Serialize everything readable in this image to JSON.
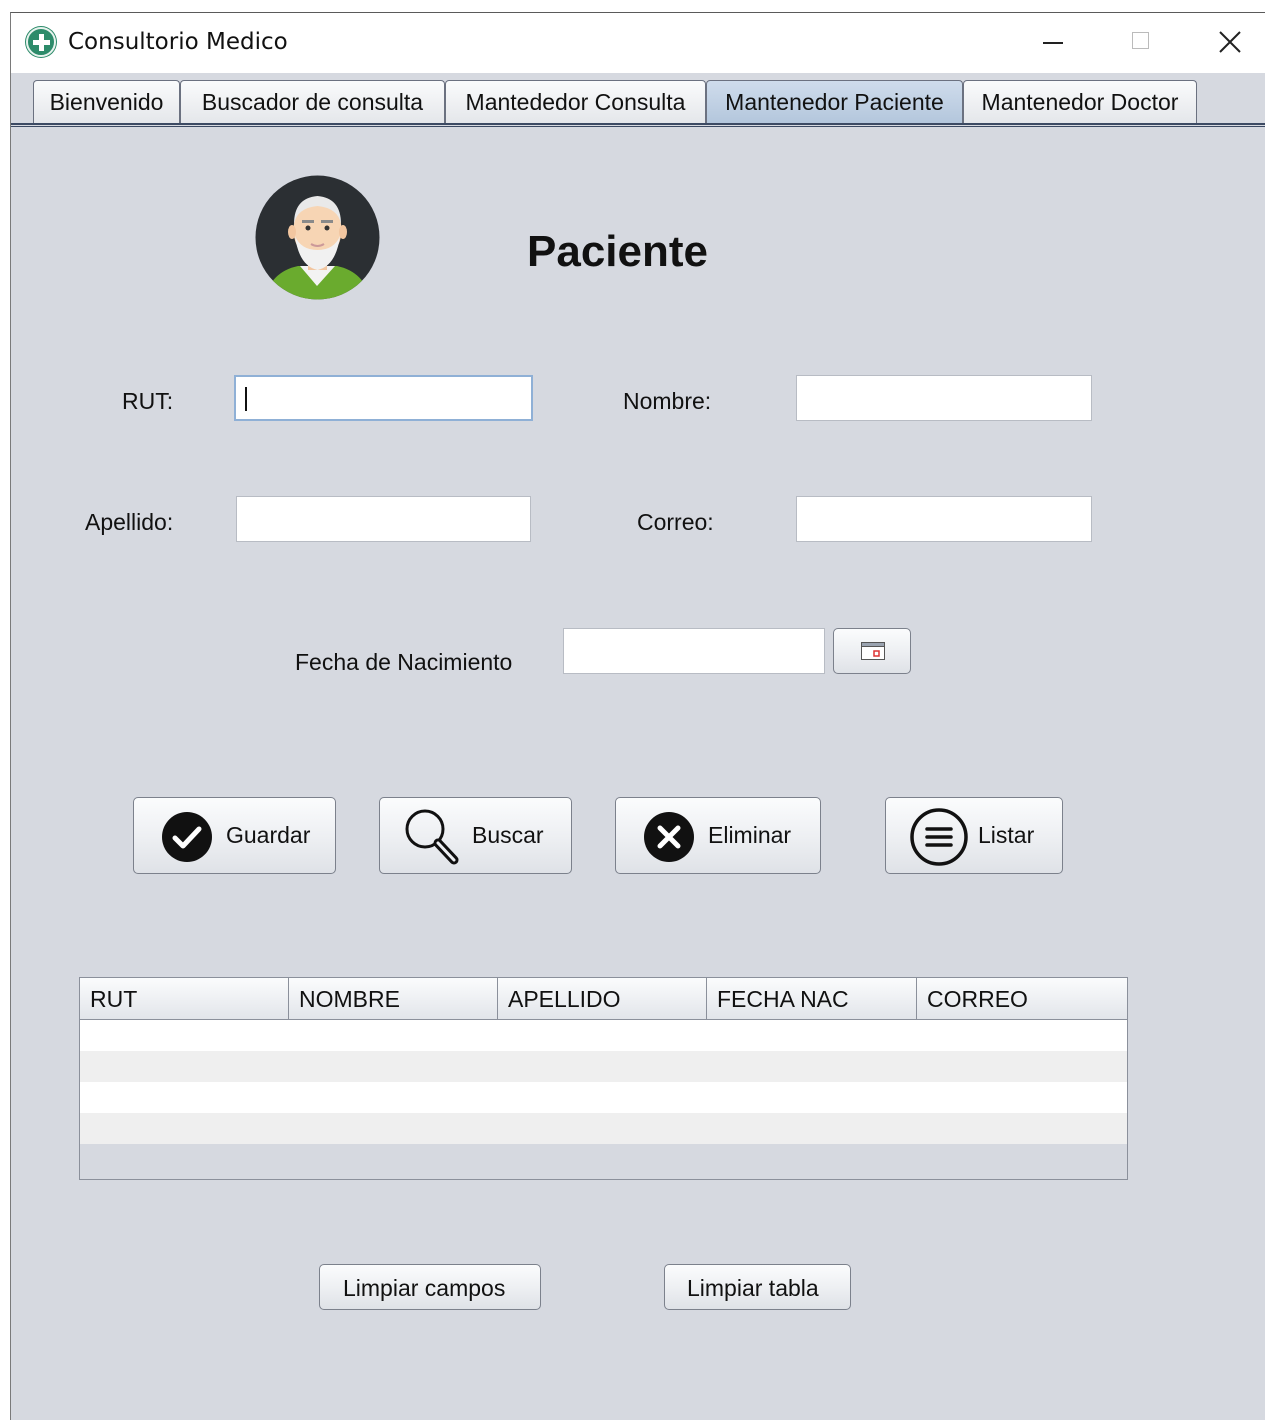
{
  "window": {
    "title": "Consultorio Medico",
    "app_icon": "medical-cross-icon",
    "controls": [
      "minimize-icon",
      "maximize-icon",
      "close-icon"
    ]
  },
  "tabs": [
    {
      "label": "Bienvenido",
      "selected": false
    },
    {
      "label": "Buscador de consulta",
      "selected": false
    },
    {
      "label": "Mantededor Consulta",
      "selected": false
    },
    {
      "label": "Mantenedor Paciente",
      "selected": true
    },
    {
      "label": "Mantenedor Doctor",
      "selected": false
    }
  ],
  "form": {
    "heading": "Paciente",
    "avatar_icon": "elderly-patient-avatar-icon",
    "rut": {
      "label": "RUT:",
      "value": ""
    },
    "nombre": {
      "label": "Nombre:",
      "value": ""
    },
    "apellido": {
      "label": "Apellido:",
      "value": ""
    },
    "correo": {
      "label": "Correo:",
      "value": ""
    },
    "fecha_nacimiento": {
      "label": "Fecha de Nacimiento",
      "value": "",
      "picker_icon": "calendar-icon"
    }
  },
  "actions": {
    "guardar": {
      "label": "Guardar",
      "icon": "checkmark-circle-icon"
    },
    "buscar": {
      "label": "Buscar",
      "icon": "magnifier-icon"
    },
    "eliminar": {
      "label": "Eliminar",
      "icon": "x-circle-icon"
    },
    "listar": {
      "label": "Listar",
      "icon": "list-circle-icon"
    }
  },
  "table": {
    "columns": [
      "RUT",
      "NOMBRE",
      "APELLIDO",
      "FECHA NAC",
      "CORREO"
    ],
    "rows": []
  },
  "footer": {
    "limpiar_campos": "Limpiar campos",
    "limpiar_tabla": "Limpiar tabla"
  },
  "colors": {
    "background": "#d6d9e0",
    "selected_tab": "#b3c6dc",
    "avatar_bg": "#2b2f33",
    "avatar_shirt": "#6aab2e"
  }
}
